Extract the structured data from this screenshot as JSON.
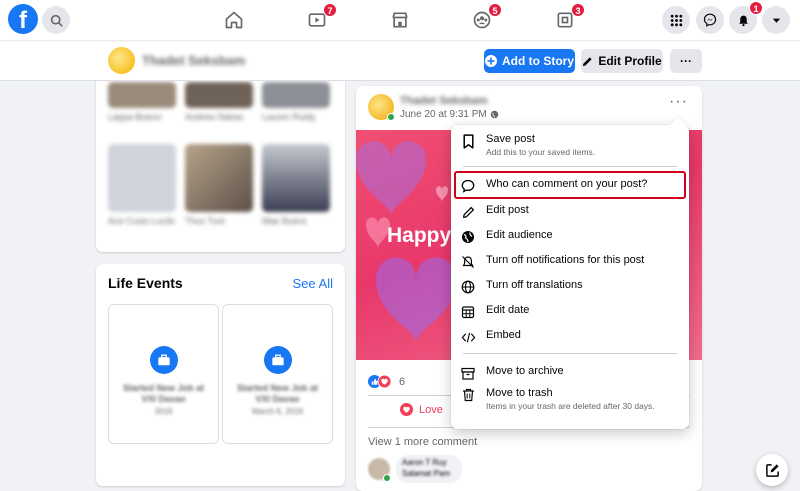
{
  "nav": {
    "logo": "f",
    "badges": {
      "watch": "7",
      "groups": "5",
      "gaming": "3",
      "notifications": "1"
    },
    "icons": [
      "search-icon",
      "home-icon",
      "watch-icon",
      "marketplace-icon",
      "groups-icon",
      "gaming-icon",
      "menu-grid-icon",
      "messenger-icon",
      "bell-icon",
      "account-caret-icon"
    ]
  },
  "profile_bar": {
    "name": "Thadet Seksbam",
    "add_story": "Add to Story",
    "edit_profile": "Edit Profile",
    "more": "···"
  },
  "friends": {
    "names": [
      "Lappa Bueno",
      "Andrew Nalow",
      "Lauren Ruidy",
      "Ace Cusio Lucilo",
      "Thus Tuol",
      "Mae Buera"
    ]
  },
  "life_events": {
    "title": "Life Events",
    "see_all": "See All",
    "items": [
      {
        "title": "Started New Job at VXI Davao",
        "date": "2016"
      },
      {
        "title": "Started New Job at VXI Davao",
        "date": "March 6, 2016"
      }
    ]
  },
  "post": {
    "author": "Thadet Seksbam",
    "date": "June 20 at 9:31 PM",
    "more": "···",
    "image_text": "Happy",
    "reaction_count": "6",
    "love_label": "Love",
    "view_more_comments": "View 1 more comment",
    "comment": {
      "author": "Aaron T Ruy",
      "text": "Salamat Pam"
    }
  },
  "menu": {
    "items": [
      {
        "label": "Save post",
        "sub": "Add this to your saved items.",
        "icon": "bookmark-icon"
      },
      {
        "label": "Who can comment on your post?",
        "icon": "comment-bubble-icon",
        "highlighted": true
      },
      {
        "label": "Edit post",
        "icon": "pencil-icon"
      },
      {
        "label": "Edit audience",
        "icon": "globe-icon"
      },
      {
        "label": "Turn off notifications for this post",
        "icon": "bell-off-icon"
      },
      {
        "label": "Turn off translations",
        "icon": "translate-icon"
      },
      {
        "label": "Edit date",
        "icon": "calendar-icon"
      },
      {
        "label": "Embed",
        "icon": "code-icon"
      },
      {
        "label": "Move to archive",
        "icon": "archive-icon"
      },
      {
        "label": "Move to trash",
        "sub": "Items in your trash are deleted after 30 days.",
        "icon": "trash-icon"
      }
    ]
  },
  "colors": {
    "brand": "#1877f2",
    "badge": "#e41e3f",
    "highlight": "#d0021b",
    "love": "#f33e58"
  }
}
